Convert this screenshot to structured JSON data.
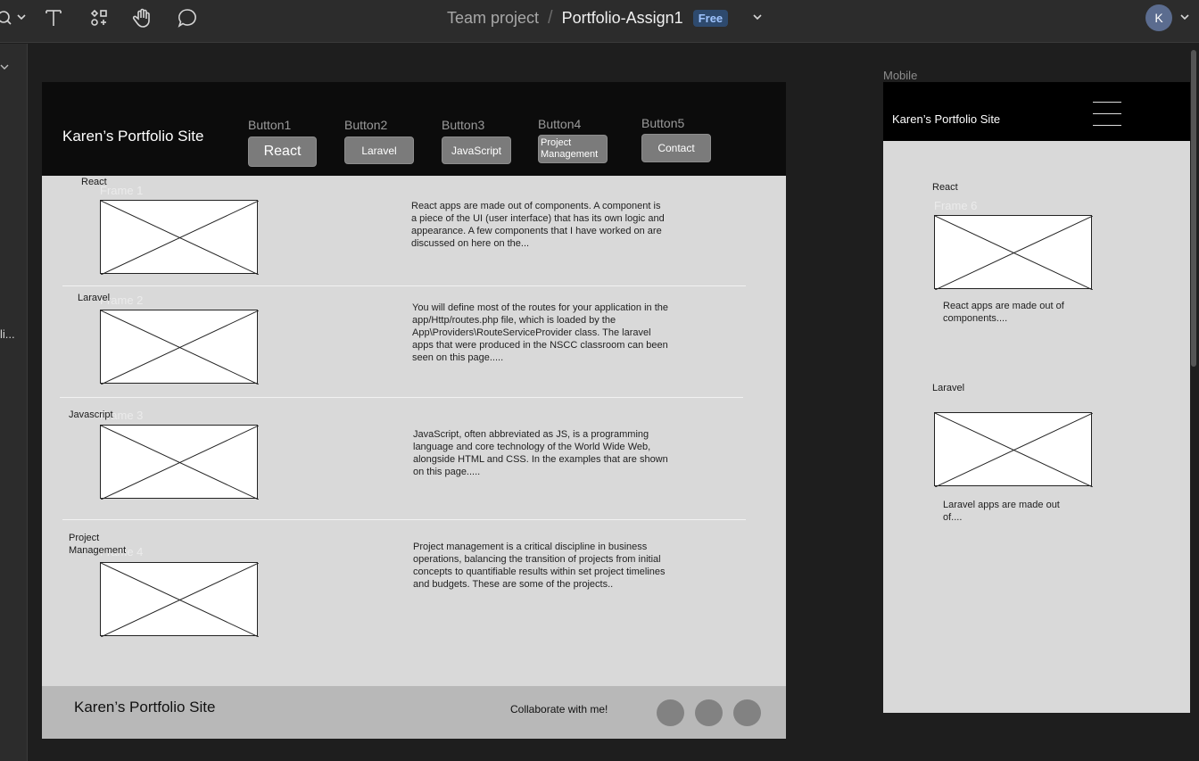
{
  "toolbar": {
    "tools": [
      "zoom-icon",
      "text-icon",
      "components-icon",
      "hand-icon",
      "comment-icon"
    ],
    "breadcrumb": {
      "team": "Team project",
      "separator": "/",
      "file": "Portfolio-Assign1"
    },
    "plan_badge": "Free",
    "avatar_initial": "K"
  },
  "sidebar": {
    "truncated_item": "li..."
  },
  "desktop": {
    "site_title": "Karen’s Portfolio Site",
    "nav": [
      {
        "caption": "Button1",
        "label": "React"
      },
      {
        "caption": "Button2",
        "label": "Laravel"
      },
      {
        "caption": "Button3",
        "label": "JavaScript"
      },
      {
        "caption": "Button4",
        "label": "Project Management"
      },
      {
        "caption": "Button5",
        "label": "Contact"
      }
    ],
    "sections": [
      {
        "label": "React",
        "frame": "Frame 1",
        "text": "React apps are made out of components. A component is a piece of the UI (user interface) that has its own logic and appearance. A few components that I have worked on are discussed on here on the..."
      },
      {
        "label": "Laravel",
        "frame": "Frame 2",
        "text": "You will define most of the routes for your application in the app/Http/routes.php file, which is loaded by the App\\Providers\\RouteServiceProvider class. The laravel apps that were produced in the NSCC classroom can been seen on this page....."
      },
      {
        "label": "Javascript",
        "frame": "Frame 3",
        "text": "JavaScript, often abbreviated as JS, is a programming language and core technology of the World Wide Web, alongside HTML and CSS. In the examples that are shown on this page....."
      },
      {
        "label": "Project Management",
        "frame": "Frame 4",
        "text": "Project management is a critical discipline in business operations, balancing the transition of projects from initial concepts to quantifiable results within set project timelines and budgets. These are some of the projects.."
      }
    ],
    "footer": {
      "site_title": "Karen’s Portfolio Site",
      "collab": "Collaborate with me!"
    }
  },
  "mobile": {
    "caption": "Mobile",
    "site_title": "Karen’s Portfolio Site",
    "sections": [
      {
        "label": "React",
        "frame": "Frame 6",
        "text": "React apps are made out of components...."
      },
      {
        "label": "Laravel",
        "text": "Laravel apps are made out of...."
      }
    ]
  }
}
